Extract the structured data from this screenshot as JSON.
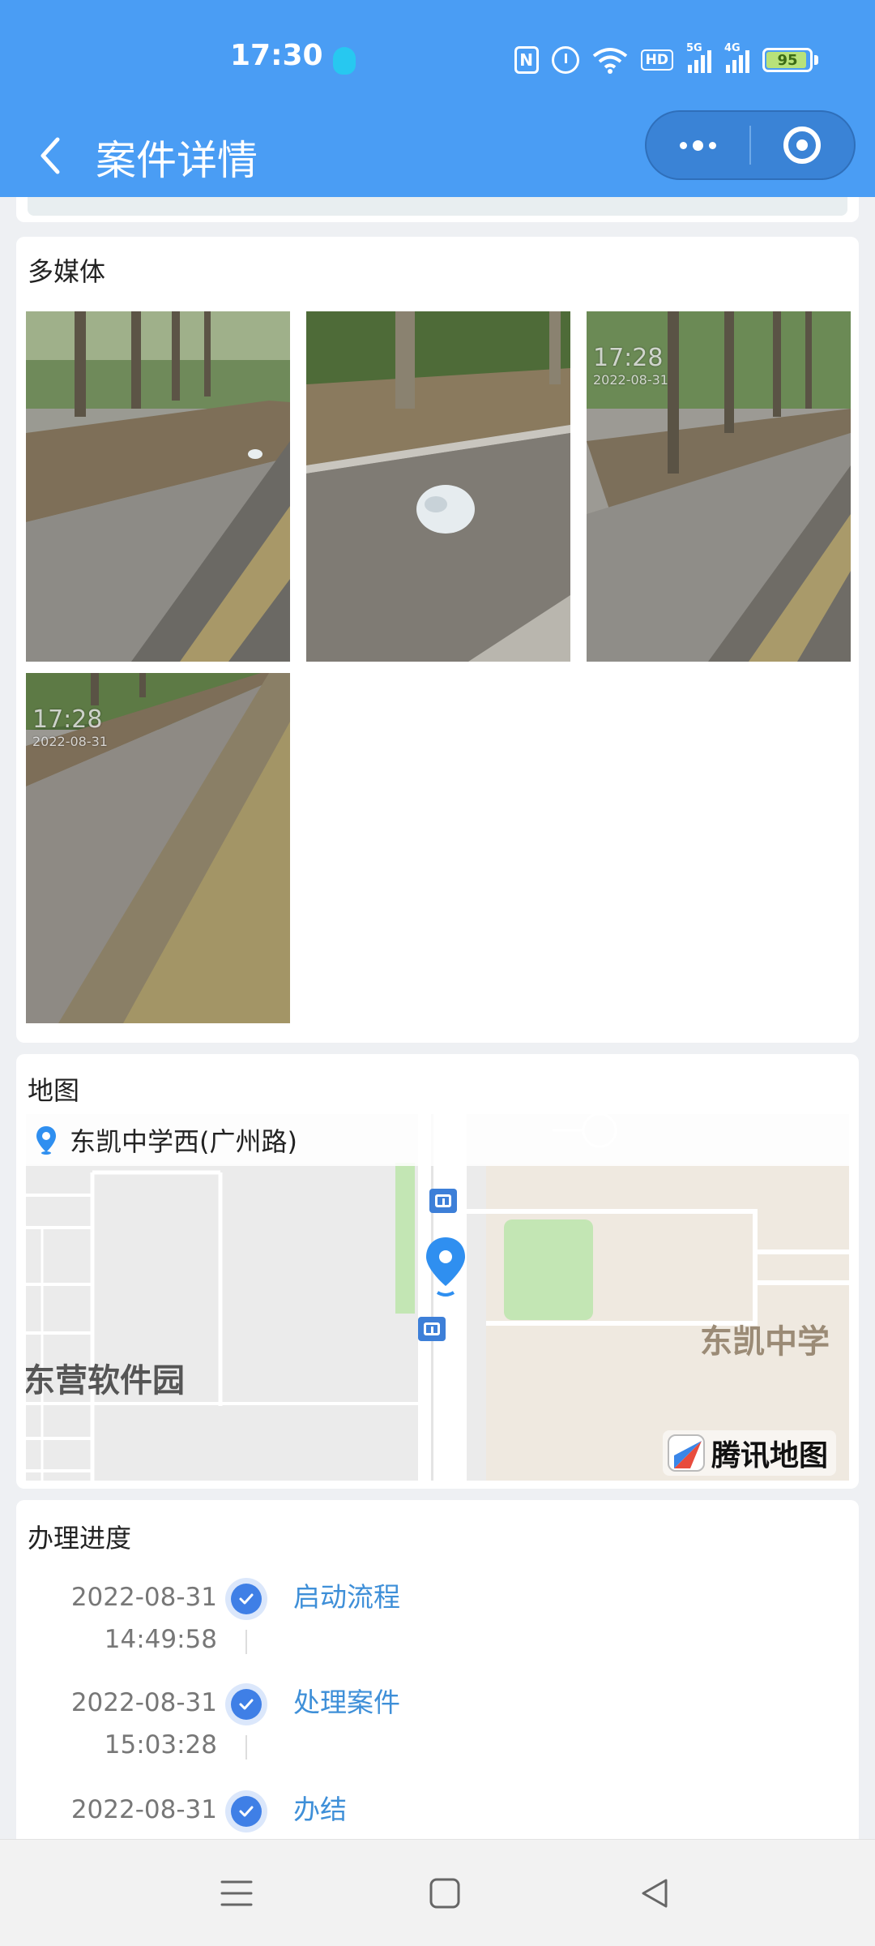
{
  "status_bar": {
    "time": "17:30",
    "icons": [
      "nfc-icon",
      "alarm-icon",
      "wifi-icon",
      "hd-icon",
      "signal-5g-icon",
      "signal-4g-icon"
    ],
    "hd_label": "HD",
    "net1_label": "5G",
    "net2_label": "4G",
    "battery_level": "95",
    "battery_fraction": 0.95
  },
  "header": {
    "title": "案件详情",
    "background_color": "#4a9df4"
  },
  "media": {
    "title": "多媒体",
    "photos": [
      {
        "stamp_time": "",
        "stamp_date": ""
      },
      {
        "stamp_time": "",
        "stamp_date": ""
      },
      {
        "stamp_time": "17:28",
        "stamp_date": "2022-08-31"
      },
      {
        "stamp_time": "17:28",
        "stamp_date": "2022-08-31"
      }
    ]
  },
  "map": {
    "title": "地图",
    "address": "东凯中学西(广州路)",
    "poi_school": "东凯中学",
    "poi_park": "东营软件园",
    "provider": "腾讯地图"
  },
  "progress": {
    "title": "办理进度",
    "accent_color": "#3f7fe6",
    "steps": [
      {
        "date": "2022-08-31",
        "time": "14:49:58",
        "label": "启动流程"
      },
      {
        "date": "2022-08-31",
        "time": "15:03:28",
        "label": "处理案件"
      },
      {
        "date": "2022-08-31",
        "time": "",
        "label": "办结"
      }
    ]
  },
  "system_nav": {
    "buttons": [
      "menu-icon",
      "home-icon",
      "back-icon"
    ]
  }
}
